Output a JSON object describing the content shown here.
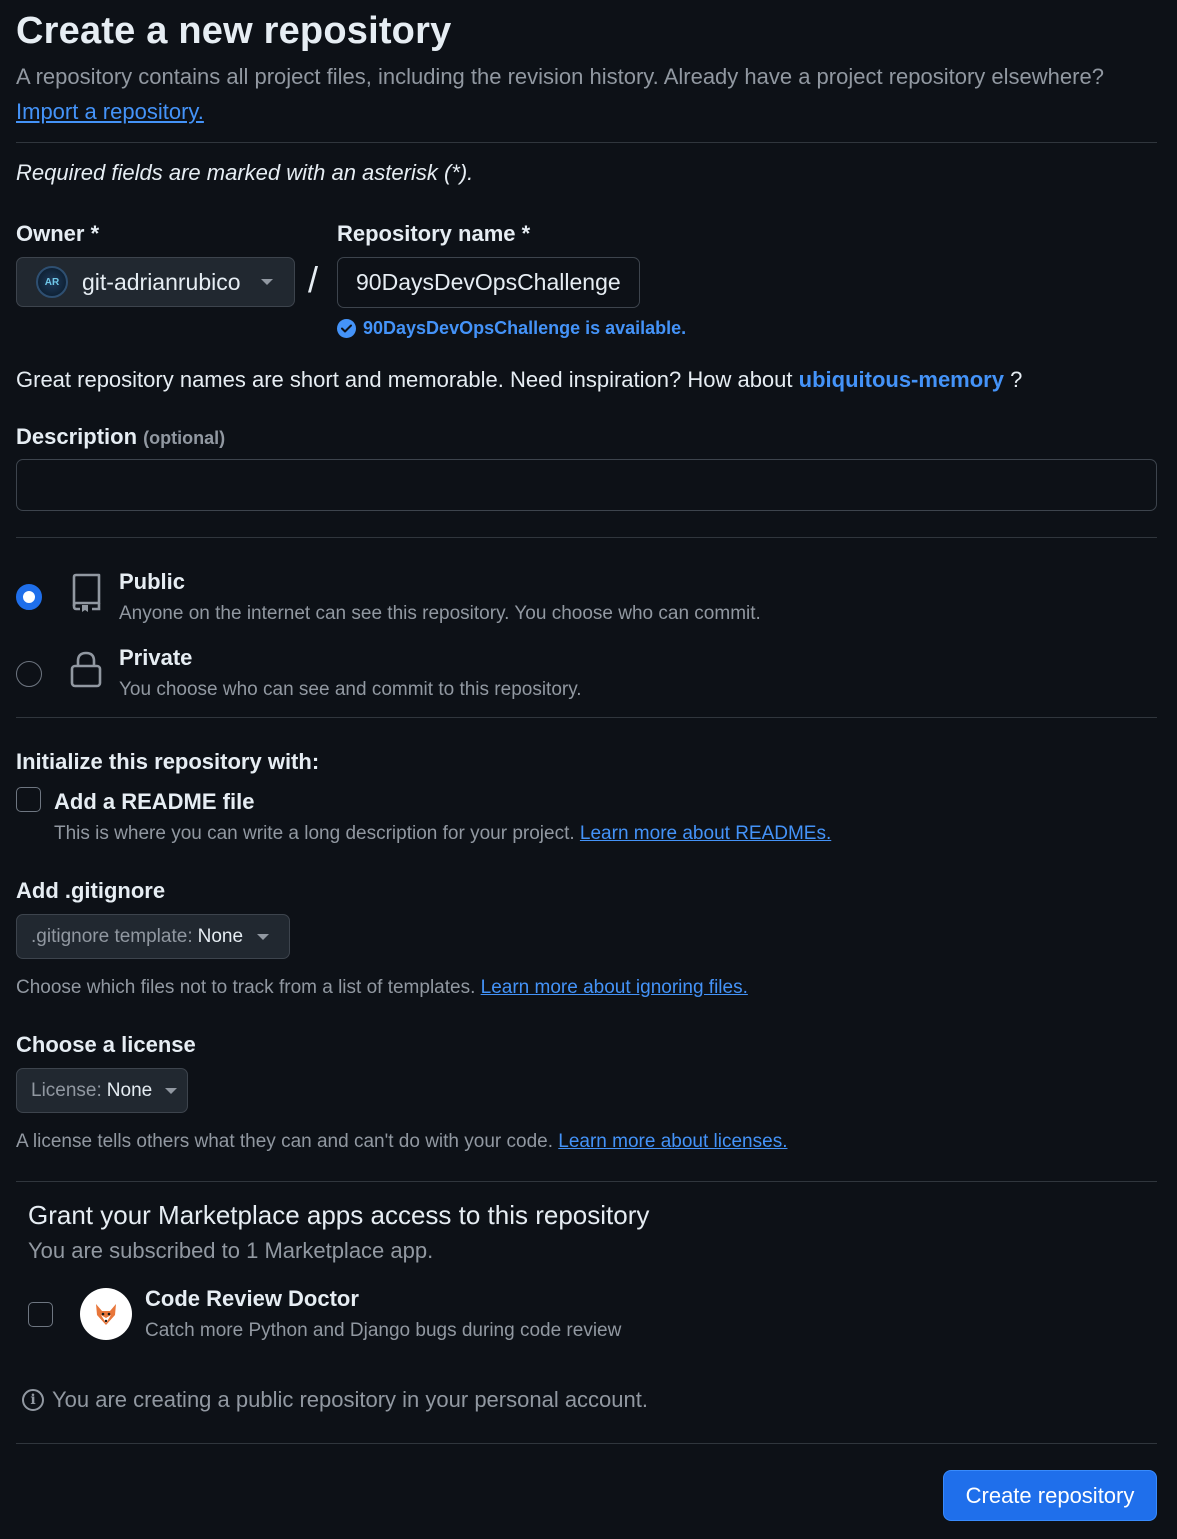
{
  "header": {
    "title": "Create a new repository",
    "subtitle": "A repository contains all project files, including the revision history. Already have a project repository elsewhere?",
    "import_link": "Import a repository."
  },
  "required_note": "Required fields are marked with an asterisk (*).",
  "owner": {
    "label": "Owner *",
    "value": "git-adrianrubico",
    "avatar_initials": "AR"
  },
  "repo_name": {
    "label": "Repository name *",
    "value": "90DaysDevOpsChallenge",
    "availability": "90DaysDevOpsChallenge is available."
  },
  "separator": "/",
  "inspiration": {
    "text": "Great repository names are short and memorable. Need inspiration? How about",
    "suggestion": "ubiquitous-memory",
    "suffix": "?"
  },
  "description": {
    "label": "Description",
    "optional": "(optional)",
    "value": ""
  },
  "visibility": {
    "options": [
      {
        "title": "Public",
        "desc": "Anyone on the internet can see this repository. You choose who can commit.",
        "selected": true,
        "icon": "repo-icon"
      },
      {
        "title": "Private",
        "desc": "You choose who can see and commit to this repository.",
        "selected": false,
        "icon": "lock-icon"
      }
    ]
  },
  "initialize": {
    "heading": "Initialize this repository with:",
    "readme_label": "Add a README file",
    "readme_desc": "This is where you can write a long description for your project.",
    "readme_link": "Learn more about READMEs.",
    "readme_checked": false
  },
  "gitignore": {
    "heading": "Add .gitignore",
    "select_prefix": ".gitignore template:",
    "select_value": "None",
    "help": "Choose which files not to track from a list of templates.",
    "help_link": "Learn more about ignoring files."
  },
  "license": {
    "heading": "Choose a license",
    "select_prefix": "License:",
    "select_value": "None",
    "help": "A license tells others what they can and can't do with your code.",
    "help_link": "Learn more about licenses."
  },
  "marketplace": {
    "title": "Grant your Marketplace apps access to this repository",
    "subtitle": "You are subscribed to 1 Marketplace app.",
    "apps": [
      {
        "name": "Code Review Doctor",
        "desc": "Catch more Python and Django bugs during code review",
        "checked": false,
        "icon": "fox-logo-icon"
      }
    ]
  },
  "info_notice": "You are creating a public repository in your personal account.",
  "create_button": "Create repository",
  "colors": {
    "background": "#0d1117",
    "accent": "#1f6feb",
    "link": "#4493f8",
    "muted_text": "#9198a1",
    "border": "#3d444d"
  }
}
